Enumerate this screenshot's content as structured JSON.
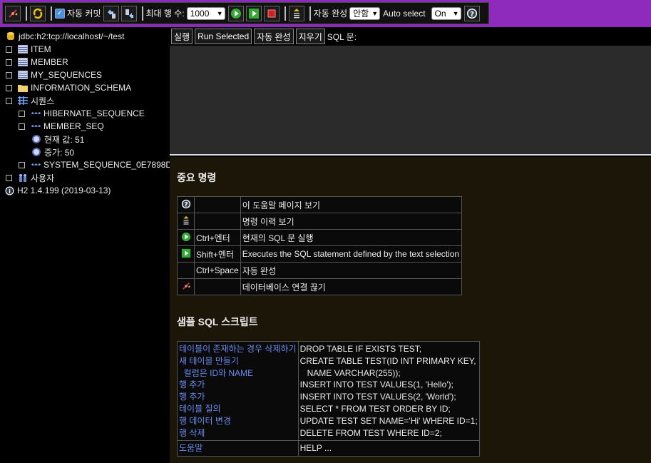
{
  "toolbar": {
    "autocommit_label": "자동 커밋",
    "max_rows_label": "최대 행 수:",
    "max_rows_value": "1000",
    "autocomplete_label": "자동 완성",
    "autocomplete_value": "안함",
    "autoselect_label": "Auto select",
    "autoselect_value": "On",
    "accent_color": "#8e2bbd"
  },
  "tree": {
    "connection": "jdbc:h2:tcp://localhost/~/test",
    "tables": [
      "ITEM",
      "MEMBER",
      "MY_SEQUENCES"
    ],
    "schema": "INFORMATION_SCHEMA",
    "sequences_label": "시퀀스",
    "seq1": "HIBERNATE_SEQUENCE",
    "seq2": "MEMBER_SEQ",
    "current_value": "현재 값: 51",
    "increment": "증가: 50",
    "seq3": "SYSTEM_SEQUENCE_0E7898D",
    "users_label": "사용자",
    "version": "H2 1.4.199 (2019-03-13)"
  },
  "sqlbar": {
    "run": "실행",
    "run_selected": "Run Selected",
    "autocomplete": "자동 완성",
    "clear": "지우기",
    "sql_label": "SQL 문:"
  },
  "help": {
    "important_title": "중요 명령",
    "commands": [
      {
        "icon": "help-icon",
        "key": "",
        "desc": "이 도움말 페이지 보기"
      },
      {
        "icon": "history-icon",
        "key": "",
        "desc": "명령 이력 보기"
      },
      {
        "icon": "run-icon",
        "key": "Ctrl+엔터",
        "desc": "현재의 SQL 문 실행"
      },
      {
        "icon": "run-selected-icon",
        "key": "Shift+엔터",
        "desc": "Executes the SQL statement defined by the text selection"
      },
      {
        "icon": "",
        "key": "Ctrl+Space",
        "desc": "자동 완성"
      },
      {
        "icon": "disconnect-icon",
        "key": "",
        "desc": "데이터베이스 연결 끊기"
      }
    ],
    "samples_title": "샘플 SQL 스크립트",
    "samples": [
      {
        "label": "테이블이 존재하는 경우 삭제하기",
        "sql": "DROP TABLE IF EXISTS TEST;"
      },
      {
        "label": "새 테이블 만들기",
        "sql": "CREATE TABLE TEST(ID INT PRIMARY KEY,"
      },
      {
        "label": "  컬럼은 ID와 NAME",
        "sql": "   NAME VARCHAR(255));"
      },
      {
        "label": "행 추가",
        "sql": "INSERT INTO TEST VALUES(1, 'Hello');"
      },
      {
        "label": "행 추가",
        "sql": "INSERT INTO TEST VALUES(2, 'World');"
      },
      {
        "label": "테이블 질의",
        "sql": "SELECT * FROM TEST ORDER BY ID;"
      },
      {
        "label": "행 데이터 변경",
        "sql": "UPDATE TEST SET NAME='Hi' WHERE ID=1;"
      },
      {
        "label": "행 삭제",
        "sql": "DELETE FROM TEST WHERE ID=2;"
      }
    ],
    "help_link": "도움말",
    "help_cmd": "HELP ..."
  }
}
